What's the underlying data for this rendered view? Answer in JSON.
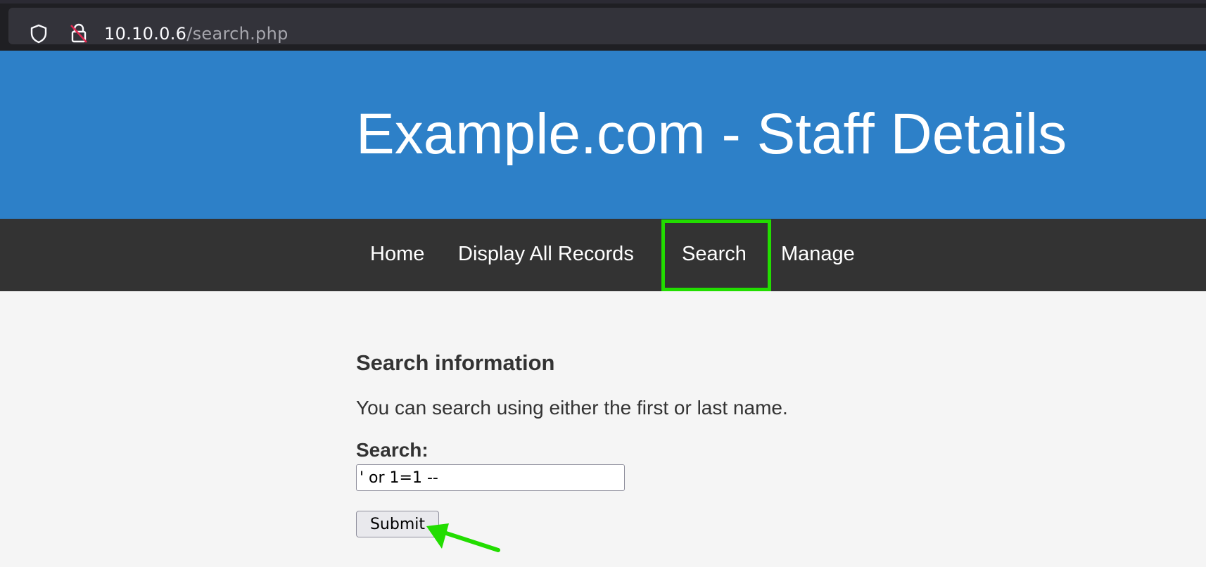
{
  "browser": {
    "url_host": "10.10.0.6",
    "url_path": "/search.php"
  },
  "site": {
    "title": "Example.com - Staff Details"
  },
  "nav": {
    "items": [
      {
        "label": "Home"
      },
      {
        "label": "Display All Records"
      },
      {
        "label": "Search"
      },
      {
        "label": "Manage"
      }
    ],
    "highlighted": "Search"
  },
  "search_form": {
    "heading": "Search information",
    "description": "You can search using either the first or last name.",
    "field_label": "Search:",
    "field_value": "' or 1=1 --",
    "submit_label": "Submit"
  },
  "colors": {
    "banner": "#2d80c8",
    "nav": "#333333",
    "highlight": "#22dd00"
  }
}
